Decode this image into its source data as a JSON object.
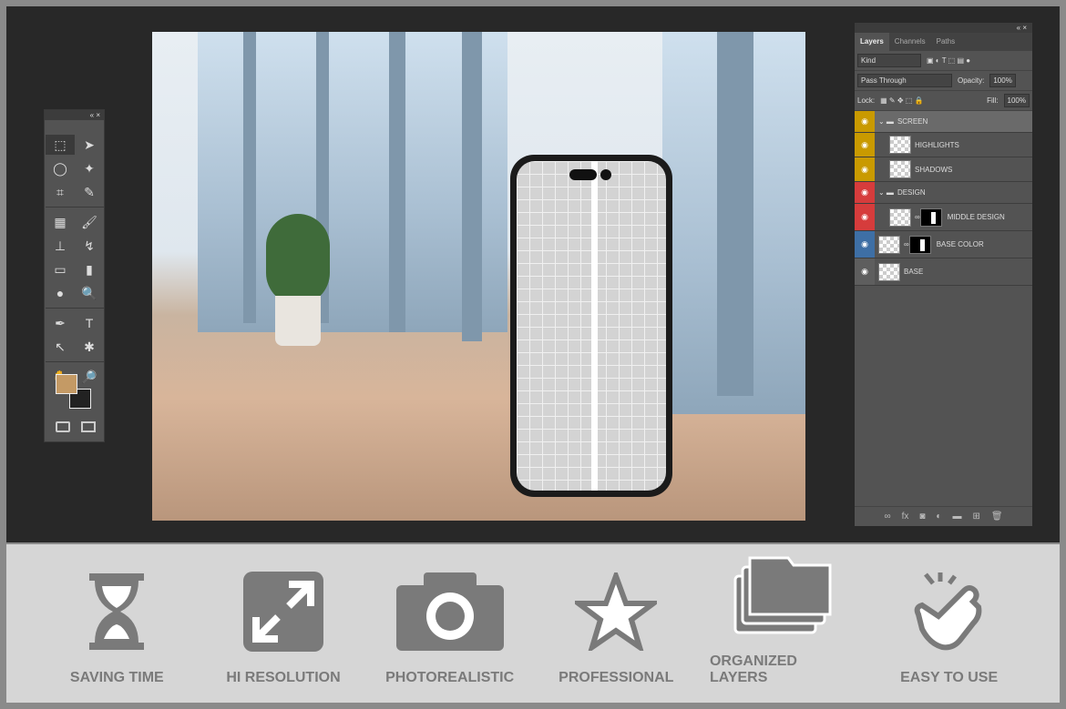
{
  "toolbar": {
    "collapse": "«",
    "close": "×",
    "tools": [
      "⬚",
      "➤",
      "◯",
      "✦",
      "⌗",
      "✎",
      "▦",
      "🖌",
      "⊥",
      "↯",
      "▭",
      "▮",
      "●",
      "🔍",
      "✒",
      "T",
      "↖",
      "✱",
      "✋",
      "🔎"
    ],
    "foreground_color": "#c49a65",
    "background_color": "#222222"
  },
  "layers_panel": {
    "collapse": "«",
    "close": "×",
    "tabs": [
      {
        "label": "Layers",
        "active": true
      },
      {
        "label": "Channels"
      },
      {
        "label": "Paths"
      }
    ],
    "filter": "Kind",
    "blend_mode": "Pass Through",
    "opacity_label": "Opacity:",
    "opacity": "100%",
    "lock_label": "Lock:",
    "fill_label": "Fill:",
    "fill": "100%",
    "layers": [
      {
        "name": "SCREEN",
        "type": "group",
        "color": "#c99a00"
      },
      {
        "name": "HIGHLIGHTS",
        "type": "layer",
        "color": "#c99a00"
      },
      {
        "name": "SHADOWS",
        "type": "layer",
        "color": "#c99a00"
      },
      {
        "name": "DESIGN",
        "type": "group",
        "color": "#d63c3c"
      },
      {
        "name": "MIDDLE DESIGN",
        "type": "layer",
        "mask": true,
        "color": "#d63c3c"
      },
      {
        "name": "BASE COLOR",
        "type": "layer",
        "mask": true,
        "color": "#3e6fa5"
      },
      {
        "name": "BASE",
        "type": "layer",
        "color": "#5e5e5e"
      }
    ],
    "footer_icons": [
      "link-icon",
      "fx-icon",
      "mask-icon",
      "adjustment-icon",
      "folder-icon",
      "new-layer-icon",
      "trash-icon"
    ]
  },
  "features": [
    {
      "label": "SAVING TIME",
      "icon": "hourglass-icon"
    },
    {
      "label": "HI RESOLUTION",
      "icon": "expand-icon"
    },
    {
      "label": "PHOTOREALISTIC",
      "icon": "camera-icon"
    },
    {
      "label": "PROFESSIONAL",
      "icon": "star-icon"
    },
    {
      "label": "ORGANIZED LAYERS",
      "icon": "layers-icon"
    },
    {
      "label": "EASY TO USE",
      "icon": "tap-hand-icon"
    }
  ]
}
